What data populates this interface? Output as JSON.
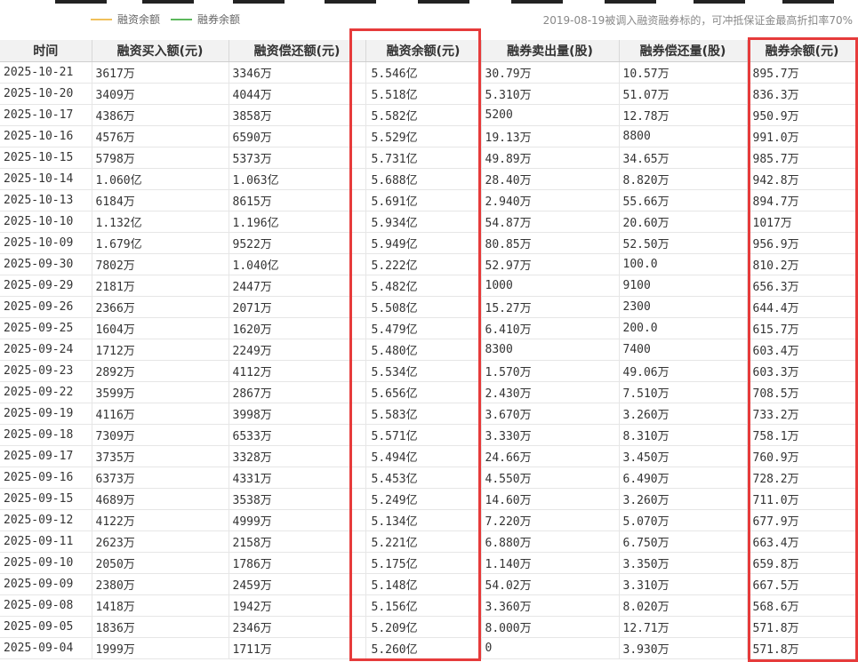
{
  "legend": {
    "items": [
      {
        "label": "融资余额",
        "color": "#f0c05a"
      },
      {
        "label": "融券余额",
        "color": "#5cb85c"
      }
    ],
    "note": "2019-08-19被调入融资融券标的，可冲抵保证金最高折扣率70%"
  },
  "table": {
    "headers": [
      "时间",
      "融资买入额(元)",
      "融资偿还额(元)",
      "融资余额(元)",
      "融券卖出量(股)",
      "融券偿还量(股)",
      "融券余额(元)"
    ],
    "rows": [
      [
        "2025-10-21",
        "3617万",
        "3346万",
        "5.546亿",
        "30.79万",
        "10.57万",
        "895.7万"
      ],
      [
        "2025-10-20",
        "3409万",
        "4044万",
        "5.518亿",
        "5.310万",
        "51.07万",
        "836.3万"
      ],
      [
        "2025-10-17",
        "4386万",
        "3858万",
        "5.582亿",
        "5200",
        "12.78万",
        "950.9万"
      ],
      [
        "2025-10-16",
        "4576万",
        "6590万",
        "5.529亿",
        "19.13万",
        "8800",
        "991.0万"
      ],
      [
        "2025-10-15",
        "5798万",
        "5373万",
        "5.731亿",
        "49.89万",
        "34.65万",
        "985.7万"
      ],
      [
        "2025-10-14",
        "1.060亿",
        "1.063亿",
        "5.688亿",
        "28.40万",
        "8.820万",
        "942.8万"
      ],
      [
        "2025-10-13",
        "6184万",
        "8615万",
        "5.691亿",
        "2.940万",
        "55.66万",
        "894.7万"
      ],
      [
        "2025-10-10",
        "1.132亿",
        "1.196亿",
        "5.934亿",
        "54.87万",
        "20.60万",
        "1017万"
      ],
      [
        "2025-10-09",
        "1.679亿",
        "9522万",
        "5.949亿",
        "80.85万",
        "52.50万",
        "956.9万"
      ],
      [
        "2025-09-30",
        "7802万",
        "1.040亿",
        "5.222亿",
        "52.97万",
        "100.0",
        "810.2万"
      ],
      [
        "2025-09-29",
        "2181万",
        "2447万",
        "5.482亿",
        "1000",
        "9100",
        "656.3万"
      ],
      [
        "2025-09-26",
        "2366万",
        "2071万",
        "5.508亿",
        "15.27万",
        "2300",
        "644.4万"
      ],
      [
        "2025-09-25",
        "1604万",
        "1620万",
        "5.479亿",
        "6.410万",
        "200.0",
        "615.7万"
      ],
      [
        "2025-09-24",
        "1712万",
        "2249万",
        "5.480亿",
        "8300",
        "7400",
        "603.4万"
      ],
      [
        "2025-09-23",
        "2892万",
        "4112万",
        "5.534亿",
        "1.570万",
        "49.06万",
        "603.3万"
      ],
      [
        "2025-09-22",
        "3599万",
        "2867万",
        "5.656亿",
        "2.430万",
        "7.510万",
        "708.5万"
      ],
      [
        "2025-09-19",
        "4116万",
        "3998万",
        "5.583亿",
        "3.670万",
        "3.260万",
        "733.2万"
      ],
      [
        "2025-09-18",
        "7309万",
        "6533万",
        "5.571亿",
        "3.330万",
        "8.310万",
        "758.1万"
      ],
      [
        "2025-09-17",
        "3735万",
        "3328万",
        "5.494亿",
        "24.66万",
        "3.450万",
        "760.9万"
      ],
      [
        "2025-09-16",
        "6373万",
        "4331万",
        "5.453亿",
        "4.550万",
        "6.490万",
        "728.2万"
      ],
      [
        "2025-09-15",
        "4689万",
        "3538万",
        "5.249亿",
        "14.60万",
        "3.260万",
        "711.0万"
      ],
      [
        "2025-09-12",
        "4122万",
        "4999万",
        "5.134亿",
        "7.220万",
        "5.070万",
        "677.9万"
      ],
      [
        "2025-09-11",
        "2623万",
        "2158万",
        "5.221亿",
        "6.880万",
        "6.750万",
        "663.4万"
      ],
      [
        "2025-09-10",
        "2050万",
        "1786万",
        "5.175亿",
        "1.140万",
        "3.350万",
        "659.8万"
      ],
      [
        "2025-09-09",
        "2380万",
        "2459万",
        "5.148亿",
        "54.02万",
        "3.310万",
        "667.5万"
      ],
      [
        "2025-09-08",
        "1418万",
        "1942万",
        "5.156亿",
        "3.360万",
        "8.020万",
        "568.6万"
      ],
      [
        "2025-09-05",
        "1836万",
        "2346万",
        "5.209亿",
        "8.000万",
        "12.71万",
        "571.8万"
      ],
      [
        "2025-09-04",
        "1999万",
        "1711万",
        "5.260亿",
        "0",
        "3.930万",
        "571.8万"
      ]
    ]
  }
}
